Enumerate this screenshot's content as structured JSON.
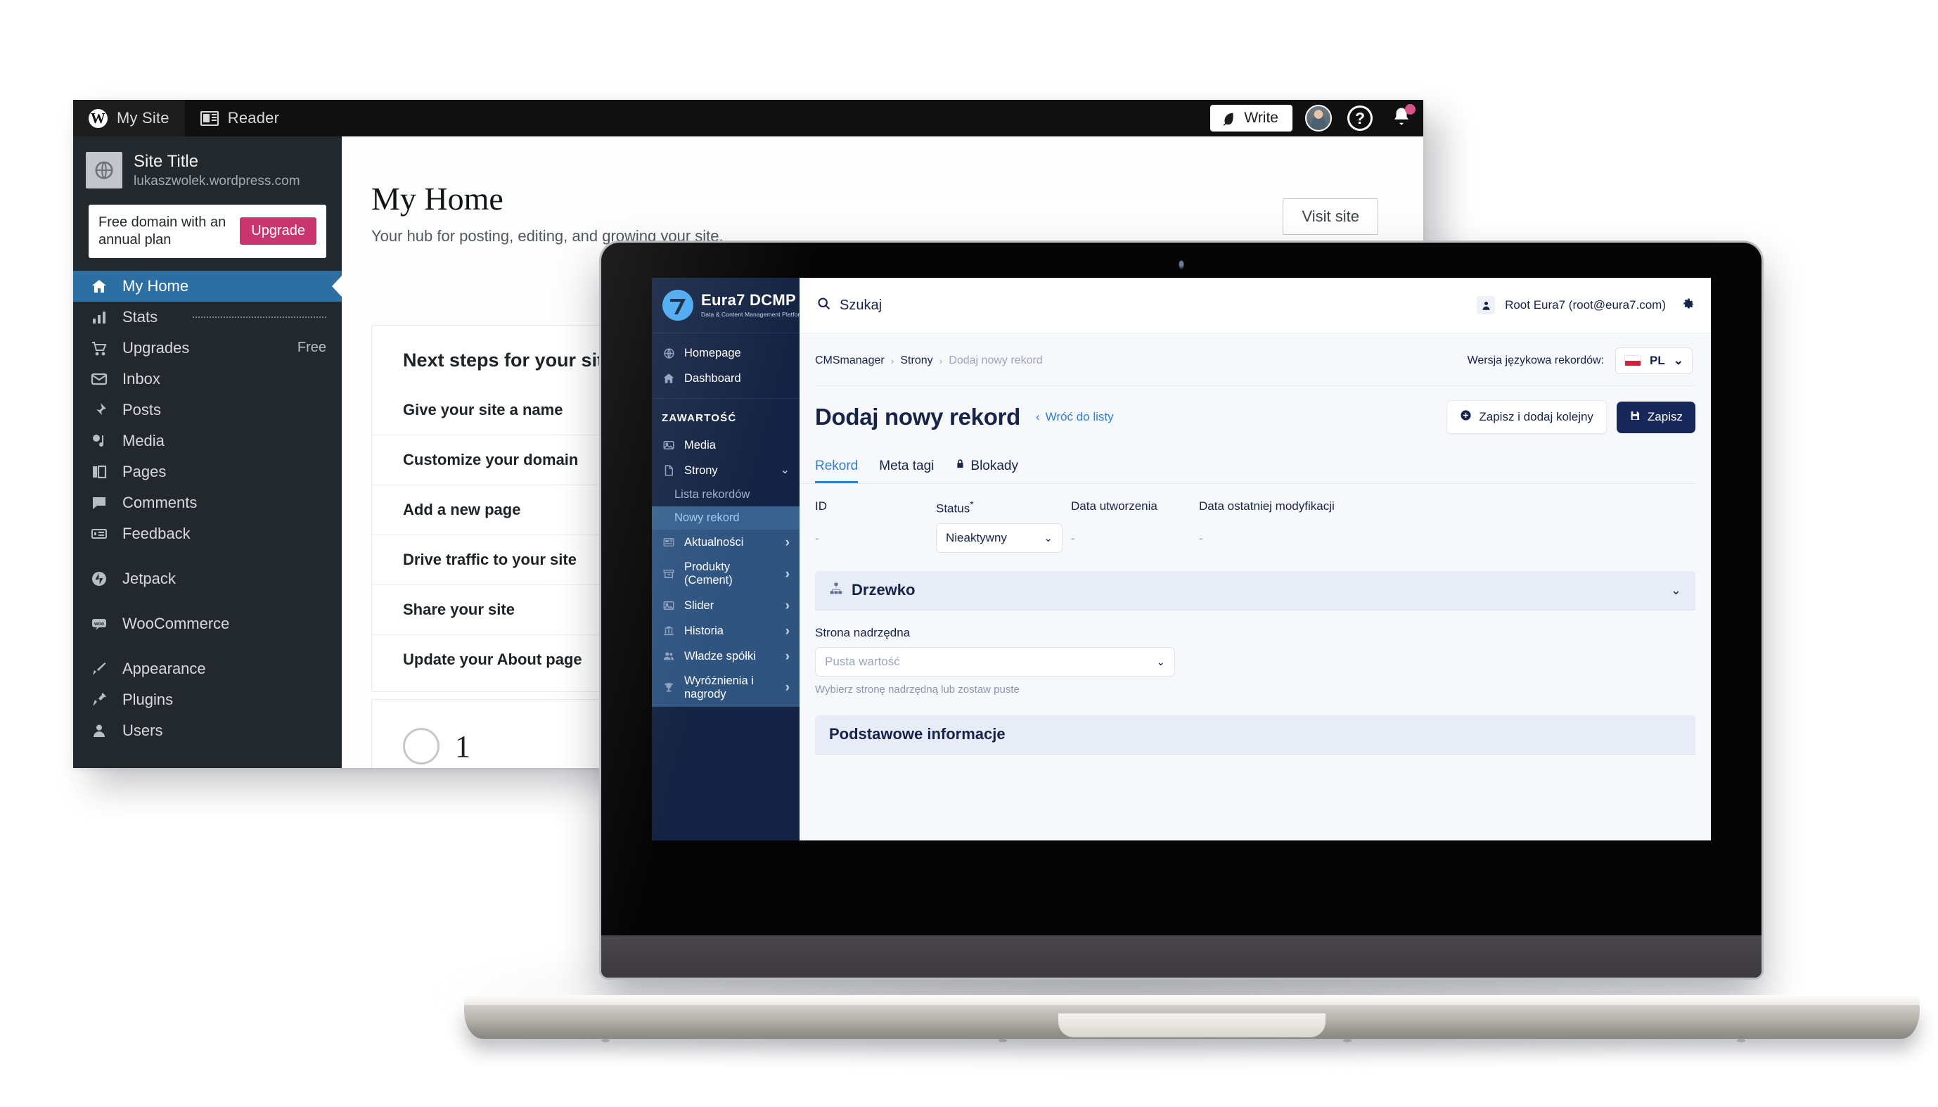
{
  "wordpress": {
    "masthead": {
      "my_site": "My Site",
      "reader": "Reader",
      "write": "Write"
    },
    "site": {
      "title": "Site Title",
      "url": "lukaszwolek.wordpress.com"
    },
    "upgrade_card": {
      "text": "Free domain with an annual plan",
      "button": "Upgrade"
    },
    "nav": [
      {
        "label": "My Home",
        "icon": "home-icon",
        "active": true,
        "right": ""
      },
      {
        "label": "Stats",
        "icon": "stats-icon",
        "active": false,
        "right": "bar"
      },
      {
        "label": "Upgrades",
        "icon": "cart-icon",
        "active": false,
        "right": "Free"
      },
      {
        "label": "Inbox",
        "icon": "envelope-icon",
        "active": false,
        "right": ""
      },
      {
        "label": "Posts",
        "icon": "pin-icon",
        "active": false,
        "right": ""
      },
      {
        "label": "Media",
        "icon": "media-icon",
        "active": false,
        "right": ""
      },
      {
        "label": "Pages",
        "icon": "pages-icon",
        "active": false,
        "right": ""
      },
      {
        "label": "Comments",
        "icon": "comment-icon",
        "active": false,
        "right": ""
      },
      {
        "label": "Feedback",
        "icon": "feedback-icon",
        "active": false,
        "right": ""
      },
      {
        "label": "Jetpack",
        "icon": "jetpack-icon",
        "active": false,
        "right": "",
        "gap_before": true
      },
      {
        "label": "WooCommerce",
        "icon": "woocommerce-icon",
        "active": false,
        "right": "",
        "gap_before": true
      },
      {
        "label": "Appearance",
        "icon": "brush-icon",
        "active": false,
        "right": "",
        "gap_before": true
      },
      {
        "label": "Plugins",
        "icon": "plug-icon",
        "active": false,
        "right": ""
      },
      {
        "label": "Users",
        "icon": "user-icon",
        "active": false,
        "right": ""
      }
    ],
    "main": {
      "title": "My Home",
      "subtitle": "Your hub for posting, editing, and growing your site.",
      "visit_site": "Visit site",
      "card_title": "Next steps for your site",
      "steps": [
        "Give your site a name",
        "Customize your domain",
        "Add a new page",
        "Drive traffic to your site",
        "Share your site",
        "Update your About page"
      ],
      "card2_number": "1"
    }
  },
  "dcmp": {
    "brand": {
      "name": "Eura7 DCMP",
      "tagline": "Data & Content Management Platform",
      "mark_text": "7"
    },
    "topbar": {
      "search_label": "Szukaj",
      "user": "Root Eura7 (root@eura7.com)"
    },
    "sidebar": {
      "primary": [
        {
          "label": "Homepage",
          "icon": "globe-icon"
        },
        {
          "label": "Dashboard",
          "icon": "home-icon"
        }
      ],
      "section_title": "ZAWARTOŚĆ",
      "items": [
        {
          "label": "Media",
          "icon": "image-icon",
          "chevron": ""
        },
        {
          "label": "Strony",
          "icon": "file-icon",
          "chevron": "down"
        },
        {
          "label": "Aktualności",
          "icon": "news-icon",
          "chevron": "right"
        },
        {
          "label": "Produkty (Cement)",
          "icon": "box-icon",
          "chevron": "right"
        },
        {
          "label": "Slider",
          "icon": "image-icon",
          "chevron": "right"
        },
        {
          "label": "Historia",
          "icon": "bank-icon",
          "chevron": "right"
        },
        {
          "label": "Władze spółki",
          "icon": "people-icon",
          "chevron": "right"
        },
        {
          "label": "Wyróżnienia i nagrody",
          "icon": "trophy-icon",
          "chevron": "right"
        }
      ],
      "strony_children": [
        {
          "label": "Lista rekordów",
          "active": false
        },
        {
          "label": "Nowy rekord",
          "active": true
        }
      ]
    },
    "breadcrumb": {
      "items": [
        "CMSmanager",
        "Strony",
        "Dodaj nowy rekord"
      ],
      "separator": "›"
    },
    "language": {
      "label": "Wersja językowa rekordów:",
      "value": "PL"
    },
    "header": {
      "title": "Dodaj nowy rekord",
      "back_link": "Wróć do listy",
      "save_and_add": "Zapisz i dodaj kolejny",
      "save": "Zapisz"
    },
    "tabs": [
      {
        "label": "Rekord",
        "active": true,
        "icon": ""
      },
      {
        "label": "Meta tagi",
        "active": false,
        "icon": ""
      },
      {
        "label": "Blokady",
        "active": false,
        "icon": "lock-icon"
      }
    ],
    "fields": {
      "id": {
        "label": "ID",
        "value": "-"
      },
      "status": {
        "label": "Status",
        "required_mark": "*",
        "value": "Nieaktywny"
      },
      "created": {
        "label": "Data utworzenia",
        "value": "-"
      },
      "modified": {
        "label": "Data ostatniej modyfikacji",
        "value": "-"
      }
    },
    "tree_panel": {
      "title": "Drzewko",
      "parent_label": "Strona nadrzędna",
      "parent_placeholder": "Pusta wartość",
      "help": "Wybierz stronę nadrzędną lub zostaw puste"
    },
    "basic_panel": {
      "title": "Podstawowe informacje"
    },
    "colors": {
      "sidebar_bg": "#152444",
      "accent_blue": "#2f7fd4",
      "brand_cyan": "#4aaaf0",
      "dark_navy": "#17275a",
      "wp_sidebar": "#23282d",
      "wp_active": "#2e6fa3",
      "wp_upgrade_pink": "#c9356e"
    }
  }
}
